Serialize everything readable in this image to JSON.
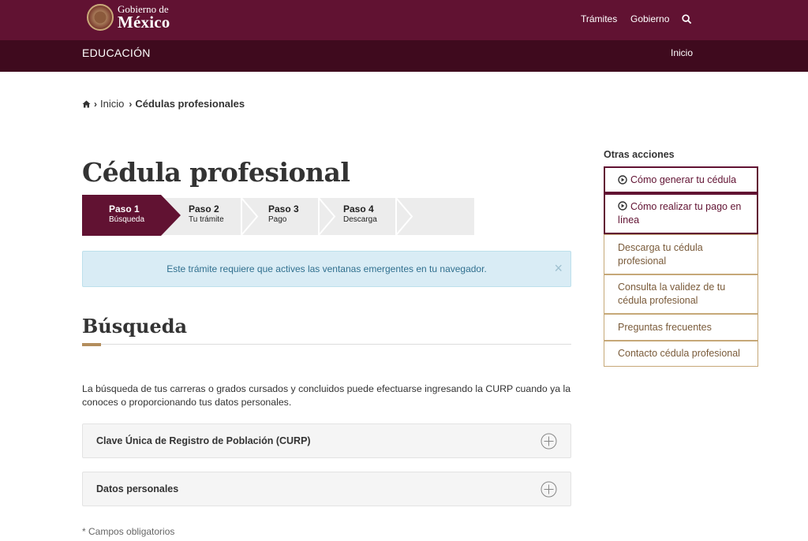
{
  "header": {
    "logo_line1": "Gobierno de",
    "logo_line2": "México",
    "nav": [
      "Trámites",
      "Gobierno"
    ]
  },
  "subheader": {
    "title": "EDUCACIÓN",
    "inicio": "Inicio"
  },
  "breadcrumb": {
    "inicio": "Inicio",
    "current": "Cédulas profesionales"
  },
  "page": {
    "title": "Cédula profesional"
  },
  "steps": [
    {
      "label": "Paso 1",
      "sub": "Búsqueda",
      "active": true
    },
    {
      "label": "Paso 2",
      "sub": "Tu trámite",
      "active": false
    },
    {
      "label": "Paso 3",
      "sub": "Pago",
      "active": false
    },
    {
      "label": "Paso 4",
      "sub": "Descarga",
      "active": false
    }
  ],
  "alert": {
    "text": "Este trámite requiere que actives las ventanas emergentes en tu navegador.",
    "close": "×"
  },
  "section": {
    "title": "Búsqueda",
    "description": "La búsqueda de tus carreras o grados cursados y concluidos puede efectuarse ingresando la CURP cuando ya la conoces o proporcionando tus datos personales."
  },
  "accordions": [
    {
      "label": "Clave Única de Registro de Población (CURP)"
    },
    {
      "label": "Datos personales"
    }
  ],
  "required_note": "* Campos obligatorios",
  "sidebar": {
    "heading": "Otras acciones",
    "items": [
      {
        "label": "Cómo generar tu cédula",
        "icon": "play-circle-icon"
      },
      {
        "label": "Cómo realizar tu pago en línea",
        "icon": "play-circle-icon"
      },
      {
        "label": "Descarga tu cédula profesional"
      },
      {
        "label": "Consulta la validez de tu cédula profesional"
      },
      {
        "label": "Preguntas frecuentes"
      },
      {
        "label": "Contacto cédula profesional"
      }
    ]
  },
  "colors": {
    "brand": "#611232",
    "brand_dark": "#3f0a1e",
    "accent_gold": "#b38e5d",
    "alert_bg": "#d9ecf5"
  }
}
